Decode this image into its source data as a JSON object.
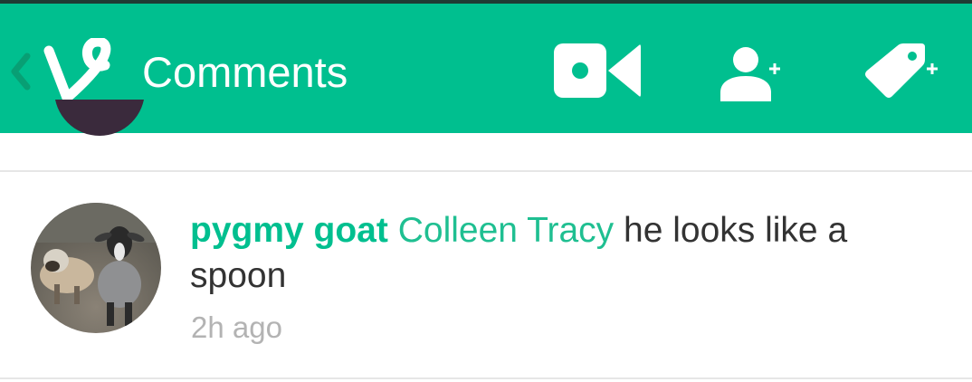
{
  "header": {
    "title": "Comments",
    "icons": [
      "back-chevron-icon",
      "vine-logo-icon",
      "video-camera-icon",
      "add-user-icon",
      "add-tag-icon"
    ],
    "colors": {
      "bar": "#00bf8f",
      "back_chevron": "#089f74",
      "text": "#ffffff"
    }
  },
  "comments": [
    {
      "username": "pygmy goat",
      "mention": "Colleen Tracy",
      "text": "he looks like a spoon",
      "time": "2h ago"
    }
  ],
  "colors": {
    "username": "#00bf8f",
    "mention": "#1fbf91",
    "body_text": "#333333",
    "timestamp": "#b3b3b3",
    "divider": "#e6e6e6"
  }
}
